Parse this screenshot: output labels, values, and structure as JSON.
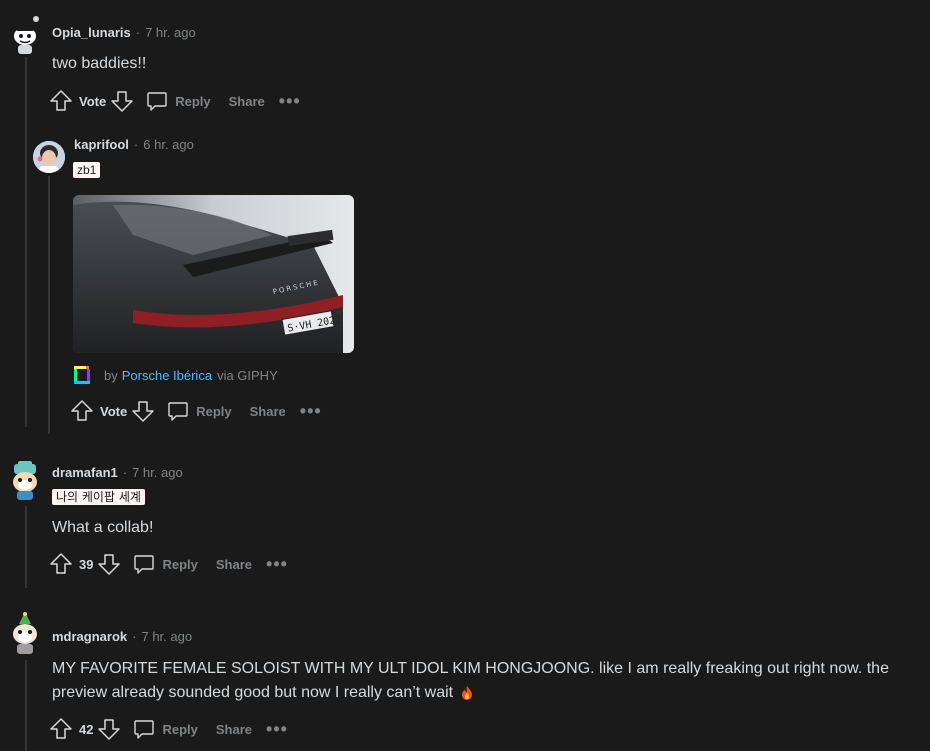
{
  "comments": [
    {
      "username": "Opia_lunaris",
      "time": "7 hr. ago",
      "body": "two baddies!!",
      "vote_label": "Vote",
      "reply_label": "Reply",
      "share_label": "Share",
      "more_label": "•••"
    },
    {
      "username": "kaprifool",
      "time": "6 hr. ago",
      "flair": "zb1",
      "gif": {
        "by_prefix": "by",
        "author": "Porsche Ibérica",
        "via": "via GIPHY"
      },
      "vote_label": "Vote",
      "reply_label": "Reply",
      "share_label": "Share",
      "more_label": "•••"
    },
    {
      "username": "dramafan1",
      "time": "7 hr. ago",
      "flair": "나의 케이팝 세계",
      "body": "What a collab!",
      "vote_label": "39",
      "reply_label": "Reply",
      "share_label": "Share",
      "more_label": "•••"
    },
    {
      "username": "mdragnarok",
      "time": "7 hr. ago",
      "body_line1": "MY FAVORITE FEMALE SOLOIST WITH MY ULT IDOL KIM HONGJOONG. like I am really freaking out right now. the",
      "body_line2": "preview already sounded good but now I really can’t wait",
      "vote_label": "42",
      "reply_label": "Reply",
      "share_label": "Share",
      "more_label": "•••"
    }
  ],
  "separator": "·",
  "icons": {
    "upvote": "upvote-icon",
    "downvote": "downvote-icon",
    "reply": "reply-icon",
    "fire": "fire-emoji"
  },
  "colors": {
    "background": "#1a1a1b",
    "text": "#d7dadc",
    "muted": "#818384",
    "link": "#4fbcff",
    "flair_bg": "#fff5f5"
  }
}
